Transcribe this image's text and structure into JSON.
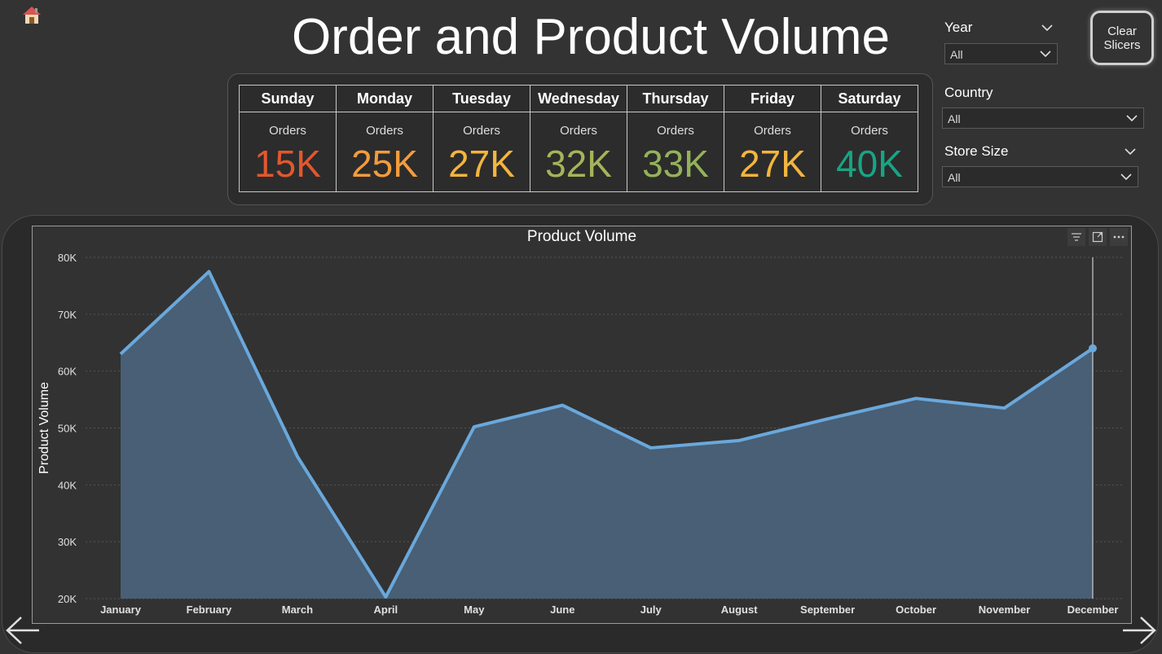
{
  "header": {
    "title": "Order and Product Volume"
  },
  "slicers": {
    "year": {
      "label": "Year",
      "value": "All"
    },
    "country": {
      "label": "Country",
      "value": "All"
    },
    "store_size": {
      "label": "Store Size",
      "value": "All"
    }
  },
  "clear_button": {
    "label": "Clear Slicers"
  },
  "days": [
    {
      "day": "Sunday",
      "sub": "Orders",
      "value": "15K",
      "color": "#e2572e"
    },
    {
      "day": "Monday",
      "sub": "Orders",
      "value": "25K",
      "color": "#f39c3d"
    },
    {
      "day": "Tuesday",
      "sub": "Orders",
      "value": "27K",
      "color": "#f3b53d"
    },
    {
      "day": "Wednesday",
      "sub": "Orders",
      "value": "32K",
      "color": "#a6b458"
    },
    {
      "day": "Thursday",
      "sub": "Orders",
      "value": "33K",
      "color": "#94b25a"
    },
    {
      "day": "Friday",
      "sub": "Orders",
      "value": "27K",
      "color": "#f3b53d"
    },
    {
      "day": "Saturday",
      "sub": "Orders",
      "value": "40K",
      "color": "#17a585"
    }
  ],
  "icons": {
    "home": "home-icon",
    "filter": "filter-icon",
    "focus": "focus-mode-icon",
    "more": "more-options-icon",
    "back": "arrow-left-icon",
    "next": "arrow-right-icon"
  },
  "colors": {
    "line": "#6aa8dc",
    "area": "#4a6279",
    "background": "#333333"
  },
  "chart_data": {
    "type": "area",
    "title": "Product Volume",
    "xlabel": "",
    "ylabel": "Product Volume",
    "categories": [
      "January",
      "February",
      "March",
      "April",
      "May",
      "June",
      "July",
      "August",
      "September",
      "October",
      "November",
      "December"
    ],
    "values": [
      63000,
      77500,
      45000,
      20300,
      50200,
      54000,
      46500,
      47800,
      51600,
      55200,
      53500,
      64000
    ],
    "ylim": [
      20000,
      80000
    ],
    "yticks": [
      {
        "value": 20000,
        "label": "20K"
      },
      {
        "value": 30000,
        "label": "30K"
      },
      {
        "value": 40000,
        "label": "40K"
      },
      {
        "value": 50000,
        "label": "50K"
      },
      {
        "value": 60000,
        "label": "60K"
      },
      {
        "value": 70000,
        "label": "70K"
      },
      {
        "value": 80000,
        "label": "80K"
      }
    ],
    "grid": true,
    "highlighted_category": "December"
  }
}
